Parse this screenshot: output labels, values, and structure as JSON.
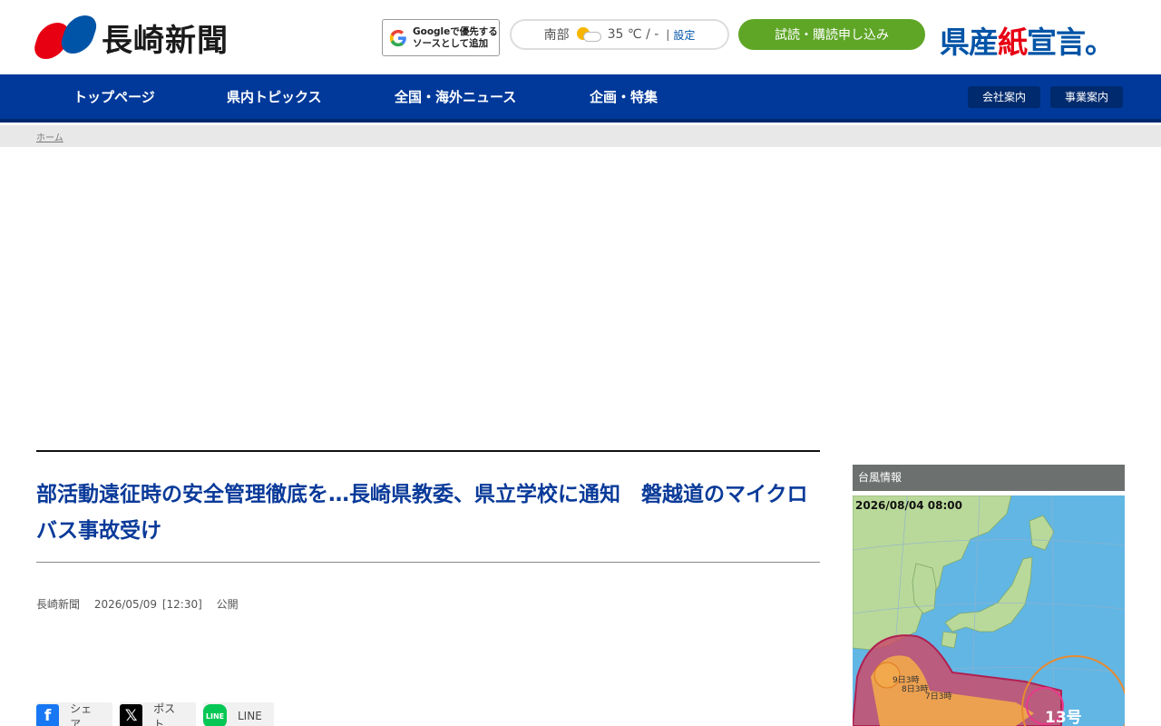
{
  "header": {
    "logo_text": "長崎新聞",
    "google_source_line1": "Googleで優先する",
    "google_source_line2": "ソースとして追加",
    "weather_region": "南部",
    "weather_temp": "35 ℃ / -",
    "weather_separator": "|",
    "weather_setting": "設定",
    "subscribe_label": "試読・購読申し込み",
    "declare_part1": "県産",
    "declare_part2": "紙",
    "declare_part3": "宣言。"
  },
  "nav": {
    "items": [
      "トップページ",
      "県内トピックス",
      "全国・海外ニュース",
      "企画・特集"
    ],
    "company": "会社案内",
    "business": "事業案内"
  },
  "breadcrumb": {
    "home": "ホーム"
  },
  "article": {
    "title": "部活動遠征時の安全管理徹底を…長崎県教委、県立学校に通知　磐越道のマイクロバス事故受け",
    "source": "長崎新聞",
    "datetime": "2026/05/09 [12:30]",
    "status": "公開"
  },
  "share": {
    "facebook": "シェア",
    "x": "ポスト",
    "line": "LINE"
  },
  "sidebar": {
    "typhoon_heading": "台風情報",
    "map_timestamp": "2026/08/04 08:00",
    "map_labels": [
      "9日3時",
      "8日3時",
      "7日3時",
      "13号"
    ]
  },
  "colors": {
    "nav_bg": "#00399a",
    "title": "#0a3a99",
    "subscribe": "#5fa627",
    "brand_red": "#e60012",
    "brand_blue": "#0054a7"
  }
}
